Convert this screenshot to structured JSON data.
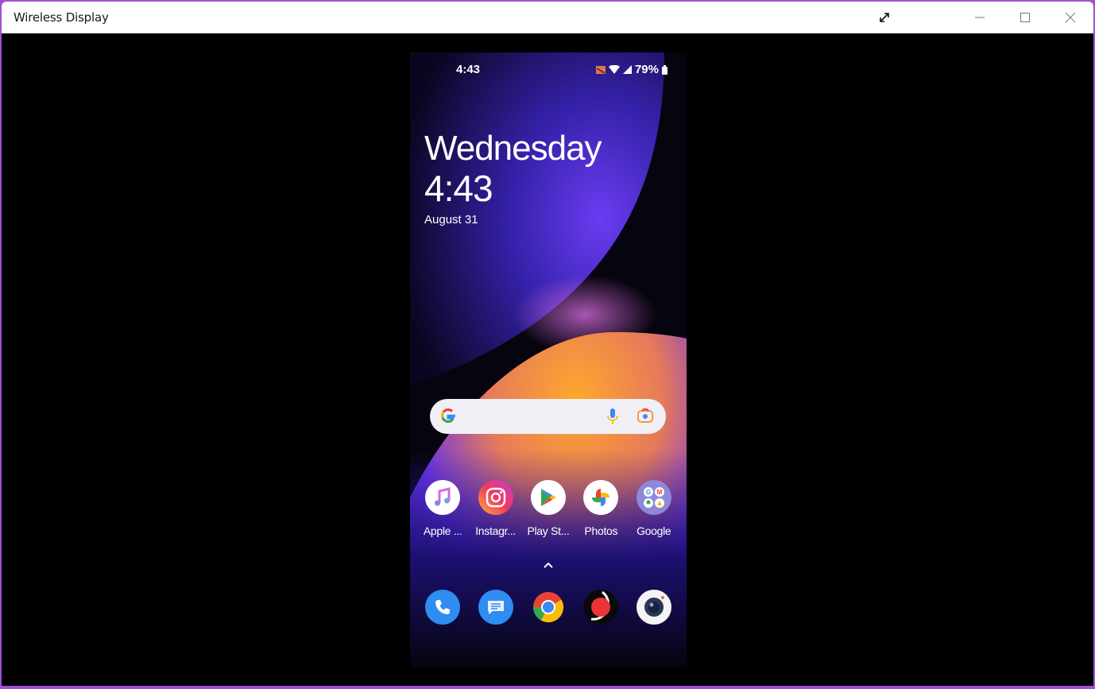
{
  "window": {
    "title": "Wireless Display",
    "controls": {
      "expand": "expand-icon",
      "minimize": "minimize-icon",
      "maximize": "maximize-icon",
      "close": "close-icon"
    }
  },
  "phone": {
    "status_bar": {
      "time": "4:43",
      "icons": [
        "cast-icon",
        "wifi-icon",
        "signal-icon"
      ],
      "battery": "79%"
    },
    "clock_widget": {
      "day": "Wednesday",
      "time": "4:43",
      "date": "August 31"
    },
    "search_bar": {
      "icons": [
        "google-g-icon",
        "mic-icon",
        "lens-icon"
      ]
    },
    "apps": [
      {
        "label": "Apple ...",
        "icon": "apple-music-icon"
      },
      {
        "label": "Instagr...",
        "icon": "instagram-icon"
      },
      {
        "label": "Play St...",
        "icon": "play-store-icon"
      },
      {
        "label": "Photos",
        "icon": "photos-icon"
      },
      {
        "label": "Google",
        "icon": "google-folder-icon"
      }
    ],
    "dock": [
      {
        "name": "phone",
        "icon": "phone-icon"
      },
      {
        "name": "messages",
        "icon": "messages-icon"
      },
      {
        "name": "chrome",
        "icon": "chrome-icon"
      },
      {
        "name": "recorder",
        "icon": "recorder-icon"
      },
      {
        "name": "camera",
        "icon": "camera-icon"
      }
    ],
    "colors": {
      "wall_purple": "#5a2fe0",
      "wall_orange": "#f7a23a"
    }
  }
}
